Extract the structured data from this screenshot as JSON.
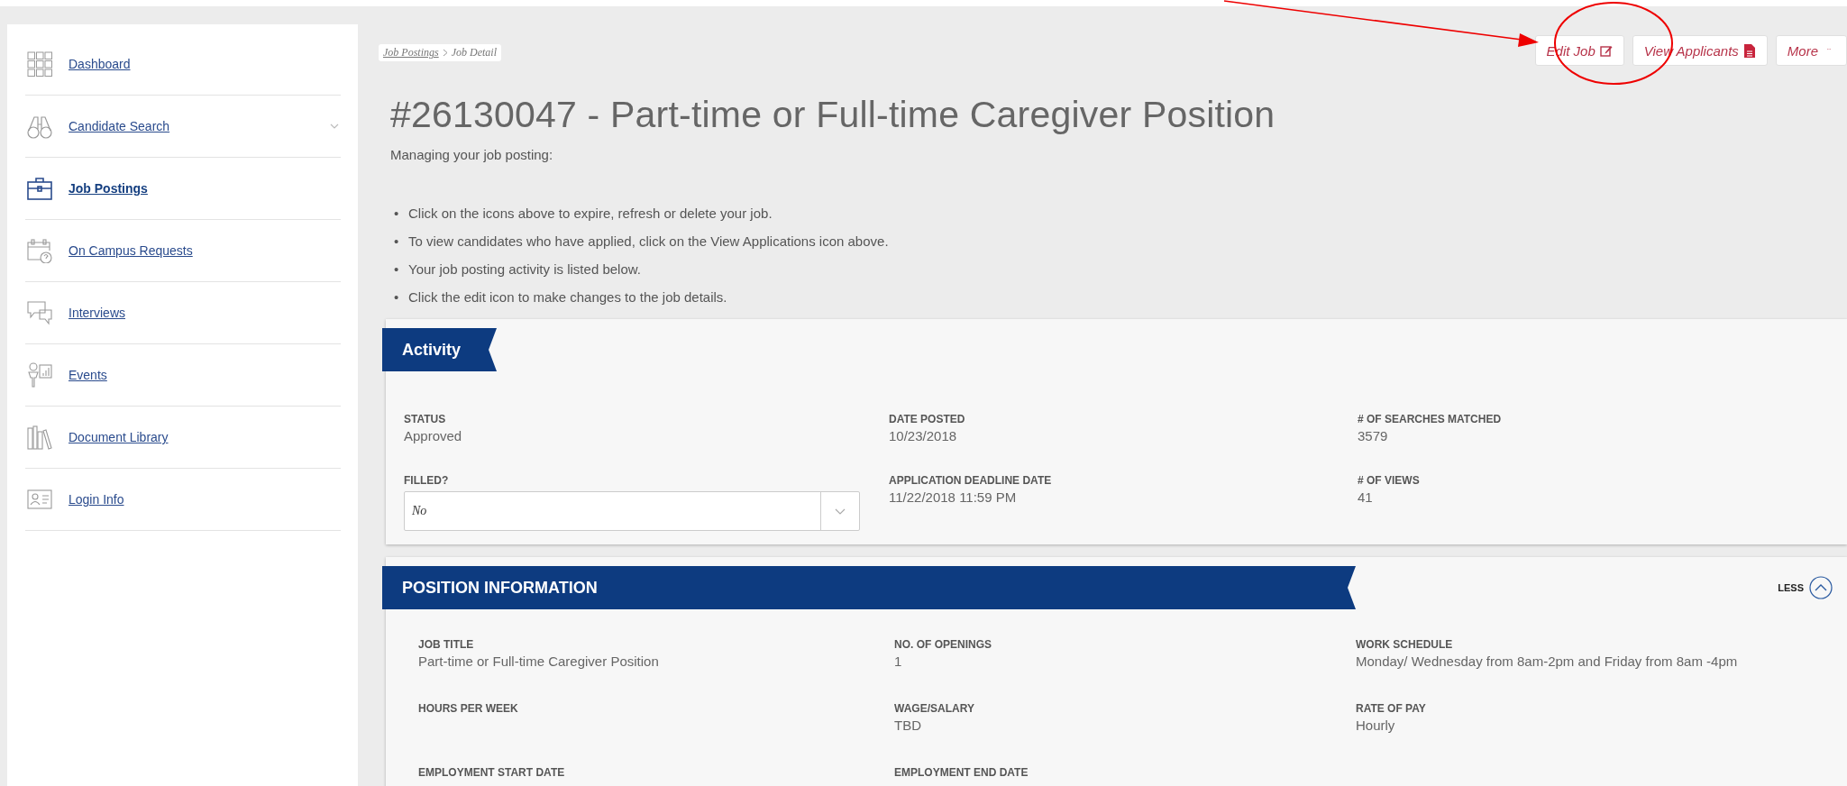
{
  "sidebar": {
    "items": [
      {
        "label": "Dashboard",
        "selected": false,
        "expandable": false
      },
      {
        "label": "Candidate Search",
        "selected": false,
        "expandable": true
      },
      {
        "label": "Job Postings",
        "selected": true,
        "expandable": false
      },
      {
        "label": "On Campus Requests",
        "selected": false,
        "expandable": false
      },
      {
        "label": "Interviews",
        "selected": false,
        "expandable": false
      },
      {
        "label": "Events",
        "selected": false,
        "expandable": false
      },
      {
        "label": "Document Library",
        "selected": false,
        "expandable": false
      },
      {
        "label": "Login Info",
        "selected": false,
        "expandable": false
      }
    ]
  },
  "breadcrumb": [
    {
      "label": "Job Postings",
      "link": true
    },
    {
      "label": "Job Detail",
      "link": false
    }
  ],
  "actions": [
    {
      "label": "Edit Job",
      "kind": "edit"
    },
    {
      "label": "View Applicants",
      "kind": "document"
    },
    {
      "label": "More",
      "kind": "more"
    }
  ],
  "title": "#26130047 - Part-time or Full-time Caregiver Position",
  "intro": "Managing your job posting:",
  "bullets": [
    {
      "marker": "•",
      "text": "Click on the icons above to expire, refresh or delete your job."
    },
    {
      "marker": "•",
      "text": "To view candidates who have applied, click on the View Applications icon above."
    },
    {
      "marker": "•",
      "text": "Your job posting activity is listed below."
    },
    {
      "marker": "•",
      "text": "Click the edit icon to make changes to the job details."
    }
  ],
  "activity": {
    "title": "Activity",
    "fields": [
      {
        "label": "STATUS",
        "value": "Approved",
        "kind": "text"
      },
      {
        "label": "DATE POSTED",
        "value": "10/23/2018",
        "kind": "text"
      },
      {
        "label": "# OF SEARCHES MATCHED",
        "value": "3579",
        "kind": "text"
      },
      {
        "label": "FILLED?",
        "value": "No",
        "kind": "select"
      },
      {
        "label": "APPLICATION DEADLINE DATE",
        "value": "11/22/2018 11:59 PM",
        "kind": "text"
      },
      {
        "label": "# OF VIEWS",
        "value": "41",
        "kind": "text"
      }
    ]
  },
  "position": {
    "title": "POSITION INFORMATION",
    "toggle": "LESS",
    "expanded": true,
    "fields": [
      {
        "label": "JOB TITLE",
        "value": "Part-time or Full-time Caregiver Position"
      },
      {
        "label": "NO. OF OPENINGS",
        "value": "1"
      },
      {
        "label": "WORK SCHEDULE",
        "value": "Monday/ Wednesday from 8am-2pm and Friday from 8am -4pm"
      },
      {
        "label": "HOURS PER WEEK"
      },
      {
        "label": "WAGE/SALARY",
        "value": "TBD"
      },
      {
        "label": "RATE OF PAY",
        "value": "Hourly"
      },
      {
        "label": "EMPLOYMENT START DATE"
      },
      {
        "label": "EMPLOYMENT END DATE"
      }
    ]
  }
}
